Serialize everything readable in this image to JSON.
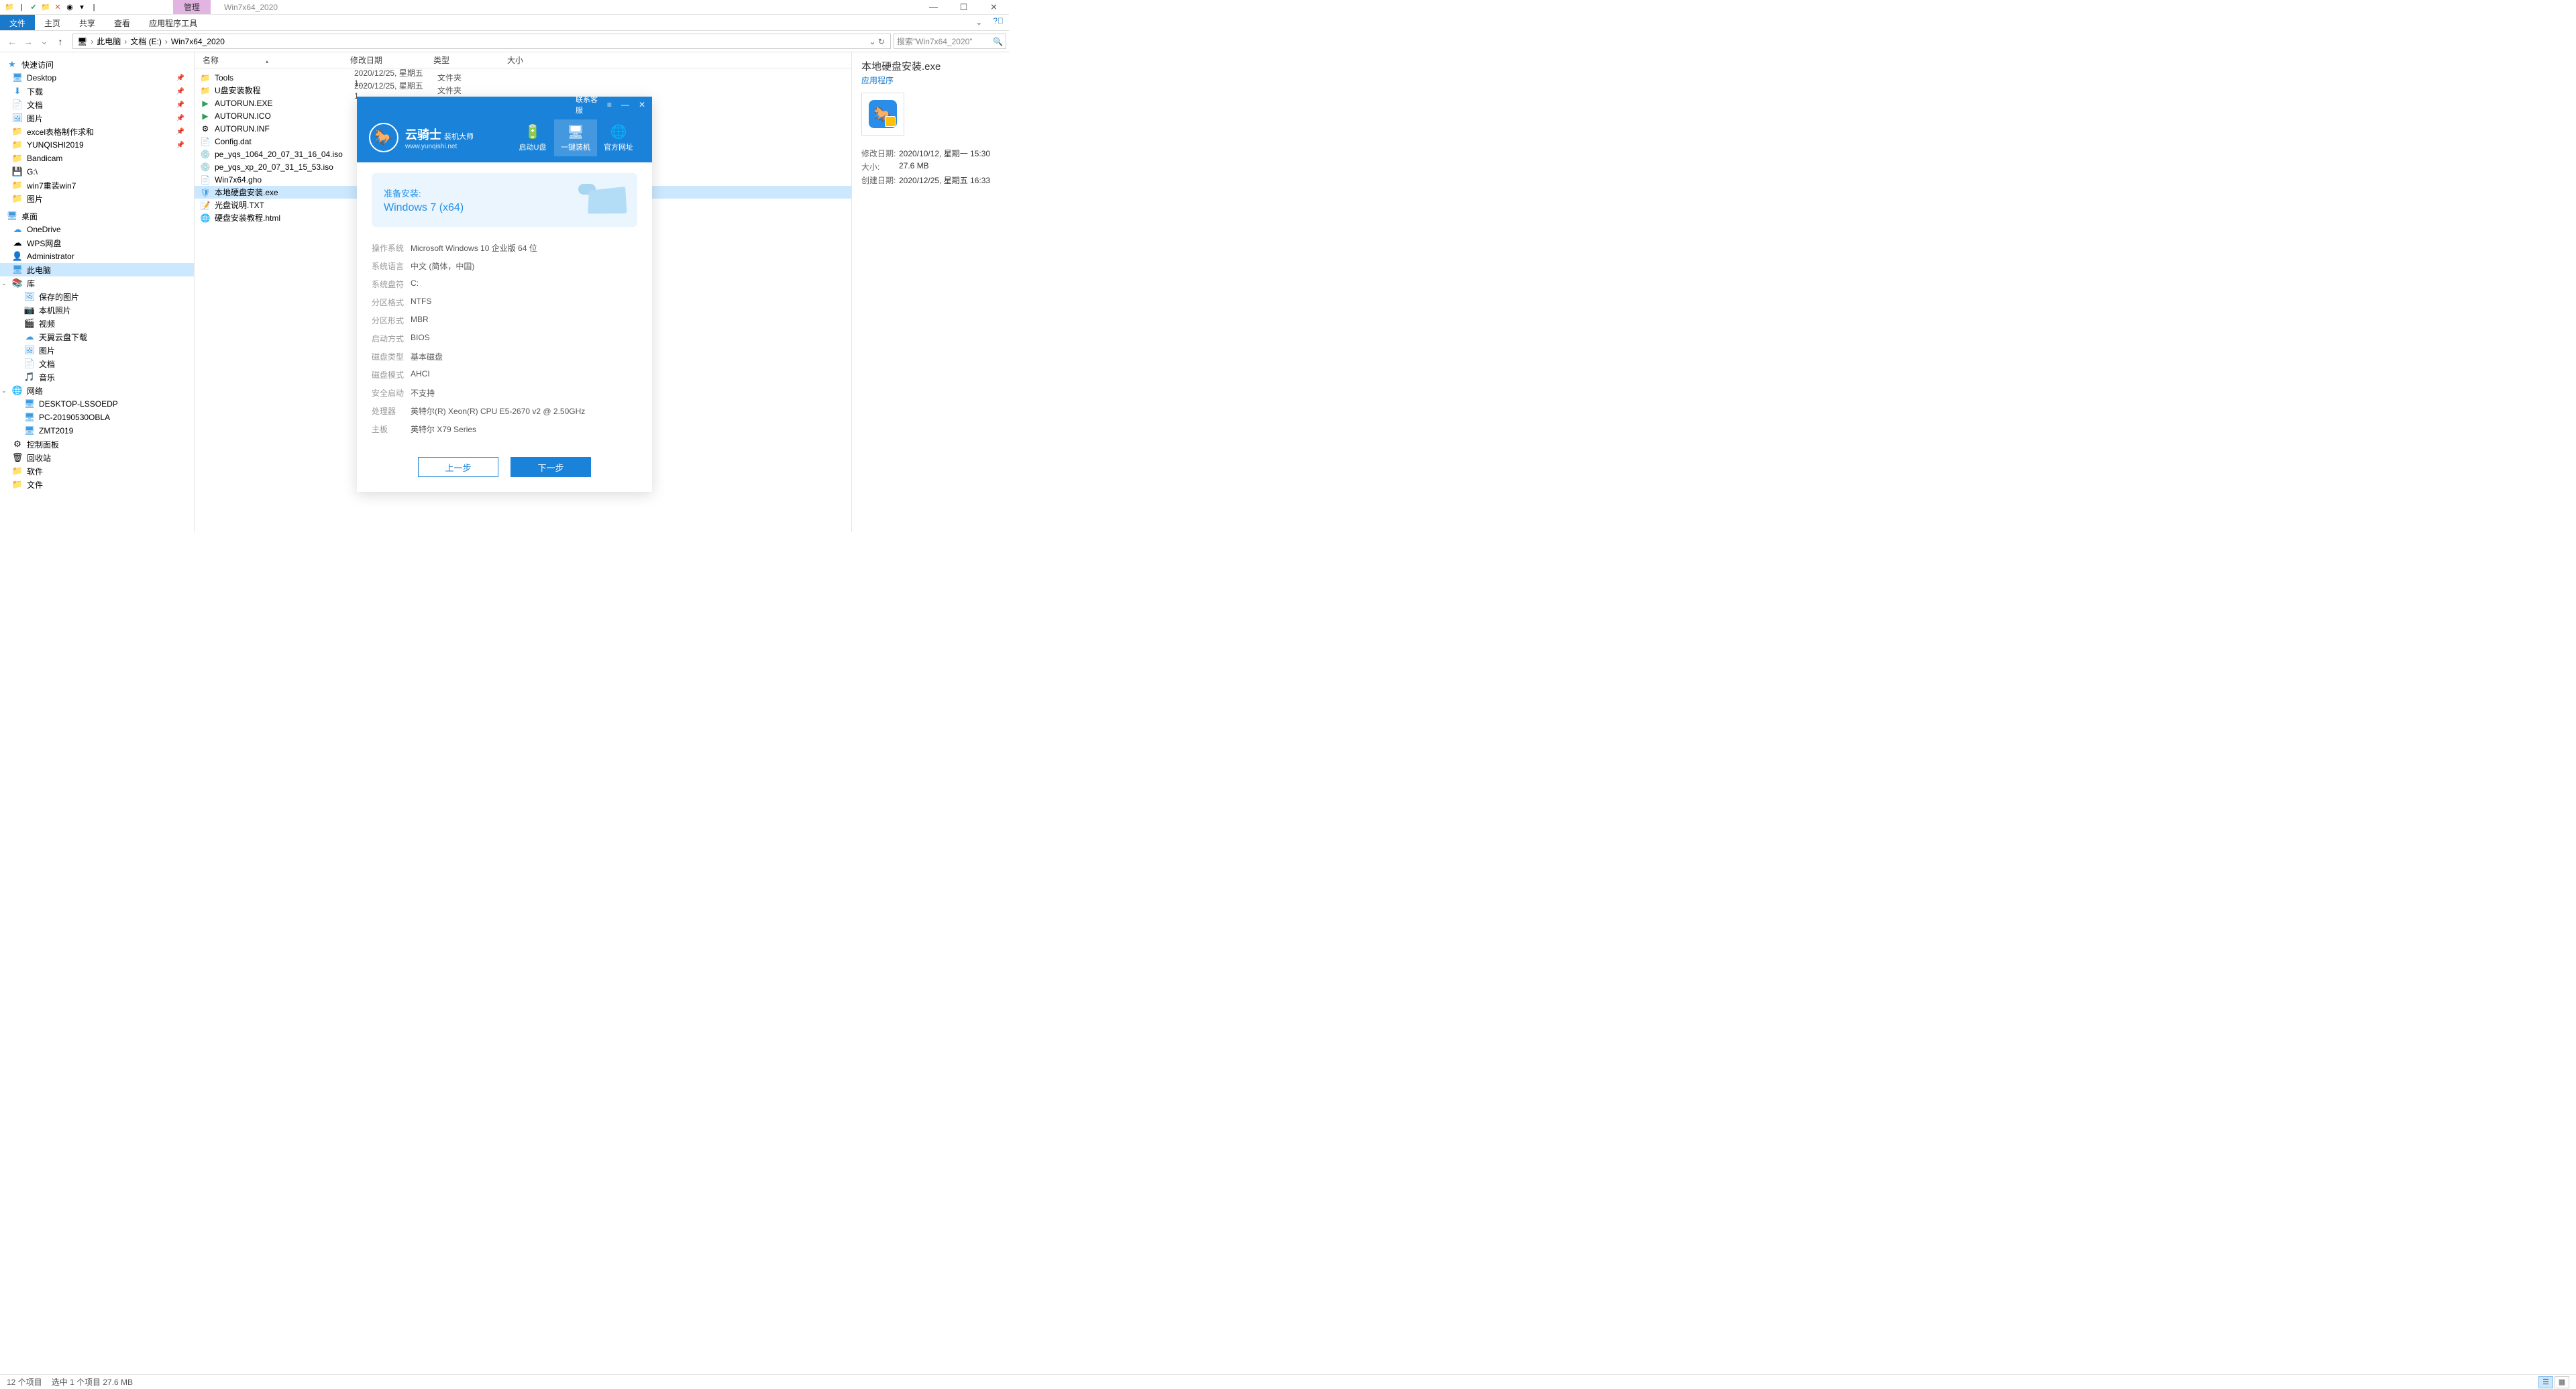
{
  "window": {
    "title": "Win7x64_2020",
    "manage_tab": "管理"
  },
  "ribbon": {
    "file": "文件",
    "tabs": [
      "主页",
      "共享",
      "查看",
      "应用程序工具"
    ]
  },
  "nav_buttons": {
    "back": "←",
    "forward": "→",
    "up": "↑"
  },
  "breadcrumb": {
    "pc_icon": "🖥",
    "parts": [
      "此电脑",
      "文档 (E:)",
      "Win7x64_2020"
    ]
  },
  "search": {
    "placeholder": "搜索\"Win7x64_2020\""
  },
  "columns": {
    "name": "名称",
    "date": "修改日期",
    "type": "类型",
    "size": "大小"
  },
  "navpane": {
    "quick": {
      "label": "快速访问",
      "items": [
        {
          "icon": "🖥",
          "label": "Desktop",
          "pin": true,
          "color": "ic-blue"
        },
        {
          "icon": "⬇",
          "label": "下载",
          "pin": true,
          "color": "ic-blue"
        },
        {
          "icon": "📄",
          "label": "文档",
          "pin": true,
          "color": "ic-blue"
        },
        {
          "icon": "🖼",
          "label": "图片",
          "pin": true,
          "color": "ic-blue"
        },
        {
          "icon": "📁",
          "label": "excel表格制作求和",
          "pin": true,
          "color": "ic-folder"
        },
        {
          "icon": "📁",
          "label": "YUNQISHI2019",
          "pin": true,
          "color": "ic-folder"
        },
        {
          "icon": "📁",
          "label": "Bandicam",
          "pin": false,
          "color": "ic-folder"
        },
        {
          "icon": "💾",
          "label": "G:\\",
          "pin": false,
          "color": "ic-disk"
        },
        {
          "icon": "📁",
          "label": "win7重装win7",
          "pin": false,
          "color": "ic-folder"
        },
        {
          "icon": "📁",
          "label": "图片",
          "pin": false,
          "color": "ic-folder"
        }
      ]
    },
    "desktop": {
      "label": "桌面",
      "items": [
        {
          "icon": "☁",
          "label": "OneDrive",
          "color": "ic-blue"
        },
        {
          "icon": "☁",
          "label": "WPS网盘",
          "color": ""
        },
        {
          "icon": "👤",
          "label": "Administrator",
          "color": ""
        },
        {
          "icon": "🖥",
          "label": "此电脑",
          "selected": true,
          "color": "ic-blue"
        },
        {
          "icon": "📚",
          "label": "库",
          "color": "ic-folder",
          "children": [
            {
              "icon": "🖼",
              "label": "保存的图片"
            },
            {
              "icon": "📷",
              "label": "本机照片"
            },
            {
              "icon": "🎬",
              "label": "视频"
            },
            {
              "icon": "☁",
              "label": "天翼云盘下载"
            },
            {
              "icon": "🖼",
              "label": "图片"
            },
            {
              "icon": "📄",
              "label": "文档"
            },
            {
              "icon": "🎵",
              "label": "音乐"
            }
          ]
        },
        {
          "icon": "🌐",
          "label": "网络",
          "color": "ic-blue",
          "children": [
            {
              "icon": "🖥",
              "label": "DESKTOP-LSSOEDP"
            },
            {
              "icon": "🖥",
              "label": "PC-20190530OBLA"
            },
            {
              "icon": "🖥",
              "label": "ZMT2019"
            }
          ]
        },
        {
          "icon": "⚙",
          "label": "控制面板",
          "color": ""
        },
        {
          "icon": "🗑",
          "label": "回收站",
          "color": ""
        },
        {
          "icon": "📁",
          "label": "软件",
          "color": "ic-folder"
        },
        {
          "icon": "📁",
          "label": "文件",
          "color": "ic-folder"
        }
      ]
    }
  },
  "files": [
    {
      "icon": "📁",
      "name": "Tools",
      "date": "2020/12/25, 星期五 1…",
      "type": "文件夹",
      "color": "ic-folder"
    },
    {
      "icon": "📁",
      "name": "U盘安装教程",
      "date": "2020/12/25, 星期五 1…",
      "type": "文件夹",
      "color": "ic-folder"
    },
    {
      "icon": "▶",
      "name": "AUTORUN.EXE",
      "date": "",
      "type": "",
      "color": "ic-green"
    },
    {
      "icon": "▶",
      "name": "AUTORUN.ICO",
      "date": "",
      "type": "",
      "color": "ic-green"
    },
    {
      "icon": "⚙",
      "name": "AUTORUN.INF",
      "date": "",
      "type": "",
      "color": ""
    },
    {
      "icon": "📄",
      "name": "Config.dat",
      "date": "",
      "type": "",
      "color": ""
    },
    {
      "icon": "💿",
      "name": "pe_yqs_1064_20_07_31_16_04.iso",
      "date": "",
      "type": "",
      "color": ""
    },
    {
      "icon": "💿",
      "name": "pe_yqs_xp_20_07_31_15_53.iso",
      "date": "",
      "type": "",
      "color": ""
    },
    {
      "icon": "📄",
      "name": "Win7x64.gho",
      "date": "",
      "type": "",
      "color": ""
    },
    {
      "icon": "🛡",
      "name": "本地硬盘安装.exe",
      "date": "",
      "type": "",
      "selected": true,
      "color": "ic-blue"
    },
    {
      "icon": "📝",
      "name": "光盘说明.TXT",
      "date": "",
      "type": "",
      "color": ""
    },
    {
      "icon": "🌐",
      "name": "硬盘安装教程.html",
      "date": "",
      "type": "",
      "color": ""
    }
  ],
  "details": {
    "title": "本地硬盘安装.exe",
    "type": "应用程序",
    "rows": [
      {
        "label": "修改日期:",
        "value": "2020/10/12, 星期一 15:30"
      },
      {
        "label": "大小:",
        "value": "27.6 MB"
      },
      {
        "label": "创建日期:",
        "value": "2020/12/25, 星期五 16:33"
      }
    ]
  },
  "statusbar": {
    "count": "12 个项目",
    "selected": "选中 1 个项目  27.6 MB"
  },
  "dialog": {
    "contact": "联系客服",
    "logo": {
      "name": "云骑士",
      "sub": "装机大师",
      "url": "www.yunqishi.net"
    },
    "nav": [
      {
        "icon": "🔋",
        "label": "启动U盘"
      },
      {
        "icon": "🖥",
        "label": "一键装机",
        "active": true
      },
      {
        "icon": "🌐",
        "label": "官方网址"
      }
    ],
    "card": {
      "line1": "准备安装:",
      "line2": "Windows 7 (x64)"
    },
    "info": [
      {
        "label": "操作系统",
        "value": "Microsoft Windows 10 企业版 64 位"
      },
      {
        "label": "系统语言",
        "value": "中文 (简体，中国)"
      },
      {
        "label": "系统盘符",
        "value": "C:"
      },
      {
        "label": "分区格式",
        "value": "NTFS"
      },
      {
        "label": "分区形式",
        "value": "MBR"
      },
      {
        "label": "启动方式",
        "value": "BIOS"
      },
      {
        "label": "磁盘类型",
        "value": "基本磁盘"
      },
      {
        "label": "磁盘模式",
        "value": "AHCI"
      },
      {
        "label": "安全启动",
        "value": "不支持"
      },
      {
        "label": "处理器",
        "value": "英特尔(R) Xeon(R) CPU E5-2670 v2 @ 2.50GHz"
      },
      {
        "label": "主板",
        "value": "英特尔 X79 Series"
      }
    ],
    "buttons": {
      "prev": "上一步",
      "next": "下一步"
    }
  }
}
